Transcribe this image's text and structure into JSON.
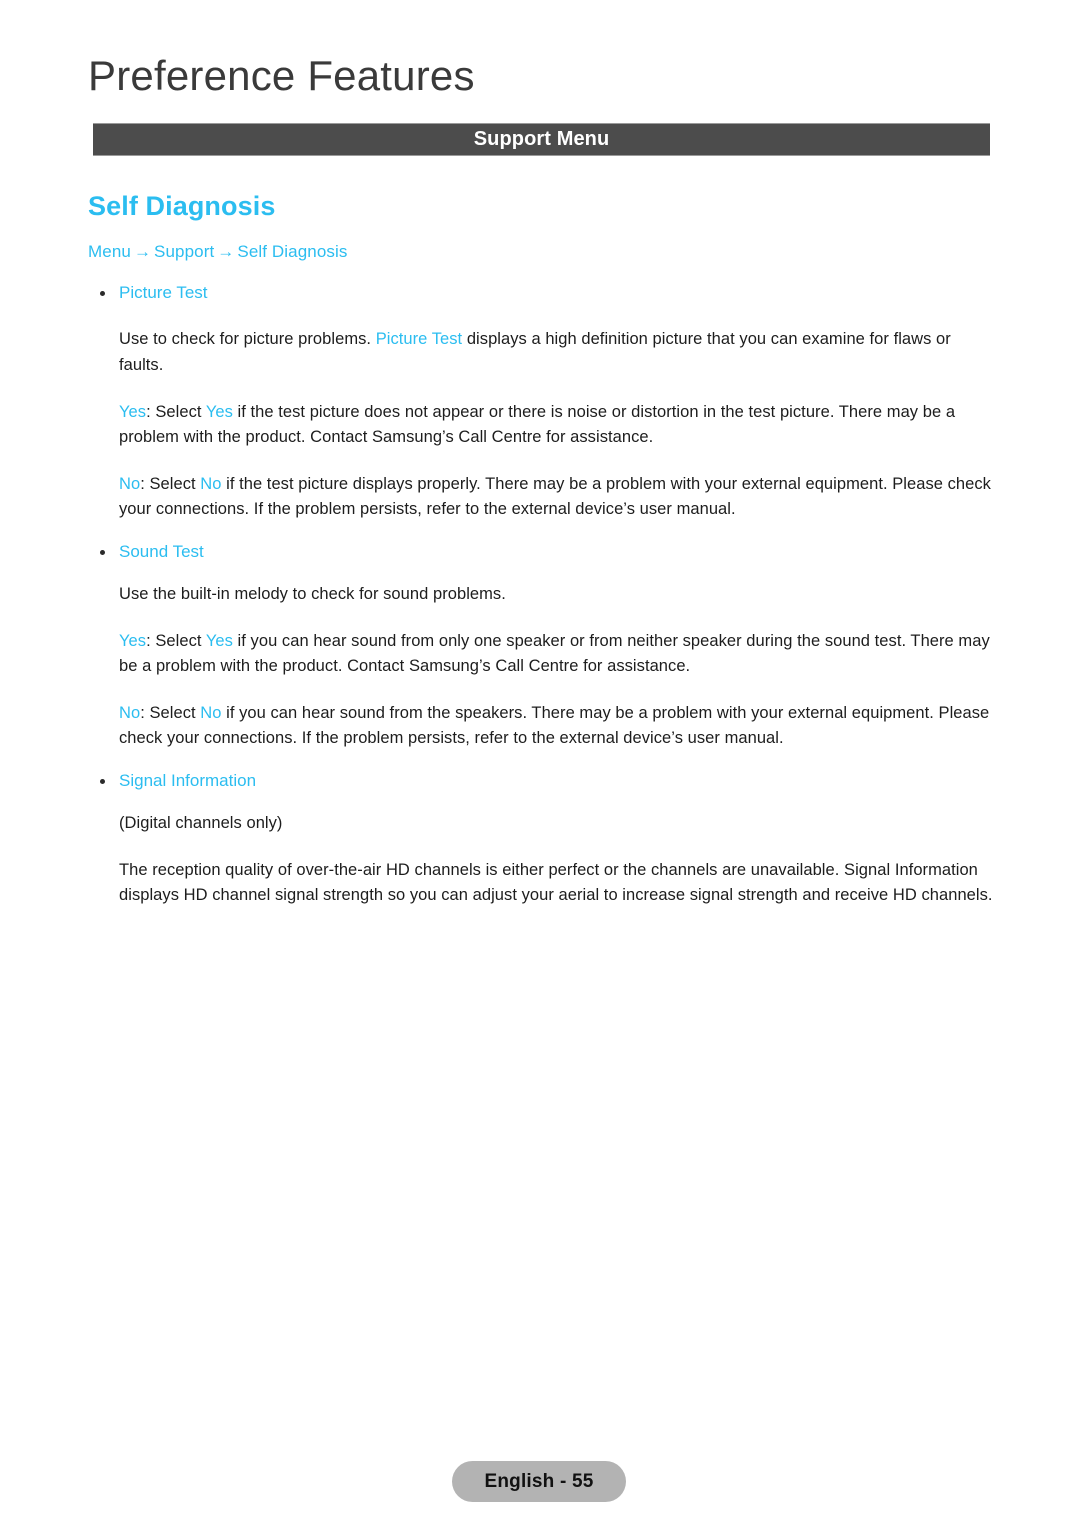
{
  "page": {
    "title": "Preference Features",
    "section_band": "Support Menu",
    "footer_label": "English - 55",
    "accent_color": "#2bbdf0",
    "band_color": "#4c4c4c",
    "footer_pill_color": "#b3b3b3"
  },
  "topic": {
    "heading": "Self Diagnosis",
    "breadcrumb": {
      "item1": "Menu",
      "arrow1": "→",
      "item2": "Support",
      "arrow2": "→",
      "item3": "Self Diagnosis"
    }
  },
  "sections": {
    "picture_test": {
      "bullet_label": "Picture Test",
      "intro": {
        "part1": "Use to check for picture problems. ",
        "highlight": "Picture Test",
        "part2": " displays a high definition picture that you can examine for flaws or faults."
      },
      "yes": {
        "key": "Yes",
        "colon": ": Select ",
        "key2": "Yes",
        "rest": " if the test picture does not appear or there is noise or distortion in the test picture. There may be a problem with the product. Contact Samsung’s Call Centre for assistance."
      },
      "no": {
        "key": "No",
        "colon": ": Select ",
        "key2": "No",
        "rest": " if the test picture displays properly. There may be a problem with your external equipment. Please check your connections. If the problem persists, refer to the external device’s user manual."
      }
    },
    "sound_test": {
      "bullet_label": "Sound Test",
      "intro": "Use the built-in melody to check for sound problems.",
      "yes": {
        "key": "Yes",
        "colon": ": Select ",
        "key2": "Yes",
        "rest": " if you can hear sound from only one speaker or from neither speaker during the sound test. There may be a problem with the product. Contact Samsung’s Call Centre for assistance."
      },
      "no": {
        "key": "No",
        "colon": ": Select ",
        "key2": "No",
        "rest": " if you can hear sound from the speakers. There may be a problem with your external equipment. Please check your connections. If the problem persists, refer to the external device’s user manual."
      }
    },
    "signal_information": {
      "bullet_label": "Signal Information",
      "note": "(Digital channels only)",
      "body": "The reception quality of over-the-air HD channels is either perfect or the channels are unavailable. Signal Information displays HD channel signal strength so you can adjust your aerial to increase signal strength and receive HD channels."
    }
  }
}
